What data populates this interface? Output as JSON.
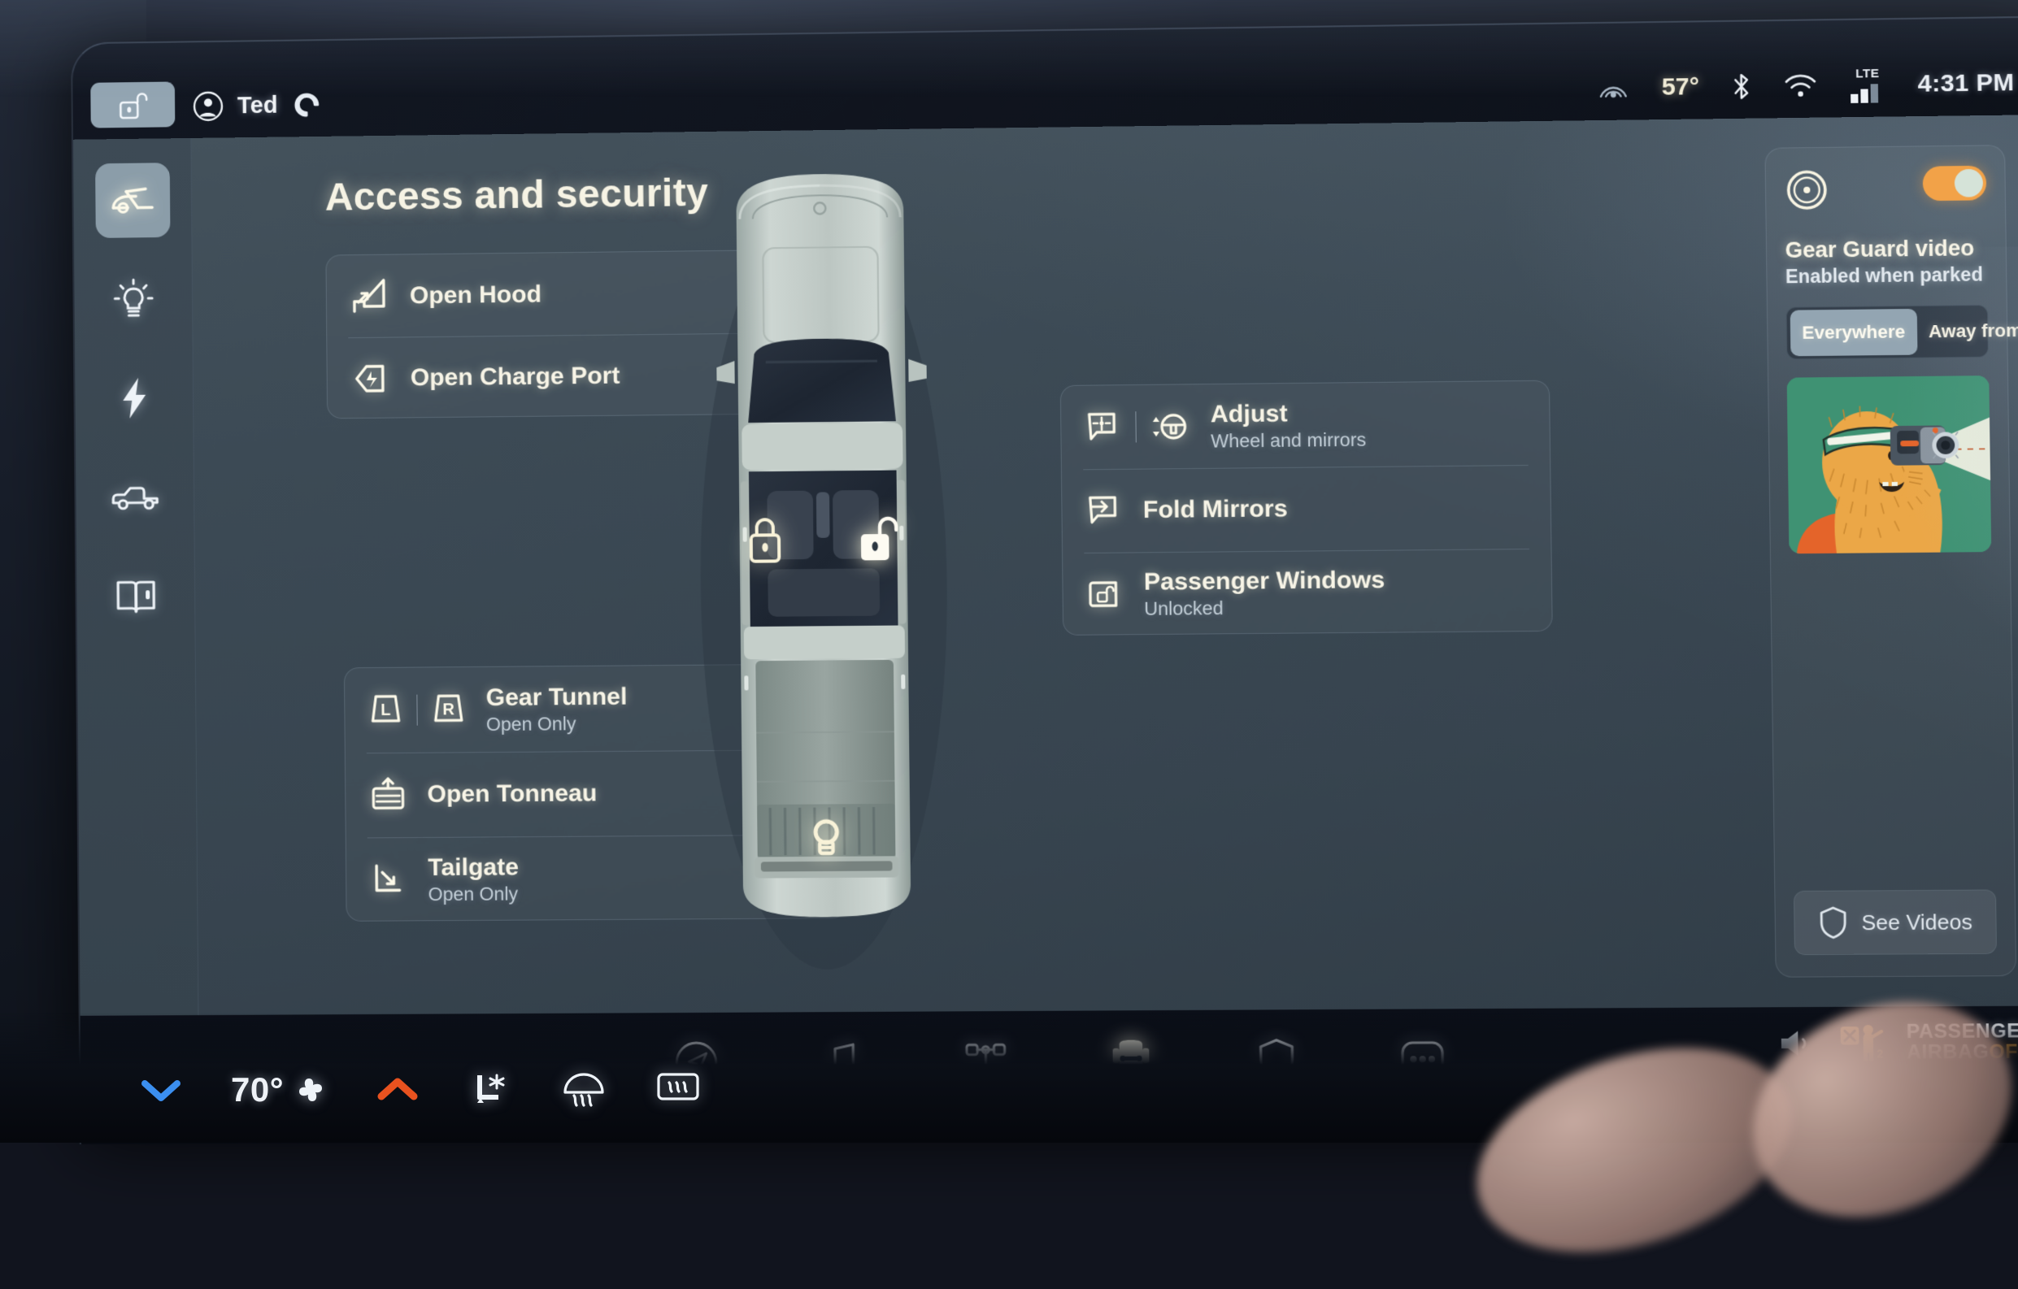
{
  "statusbar": {
    "unlock_icon": "unlock-icon",
    "driver_name": "Ted",
    "assistant_icon": "alexa-icon",
    "radar_icon": "radar-icon",
    "temperature": "57°",
    "bluetooth_icon": "bluetooth-icon",
    "wifi_icon": "wifi-icon",
    "network_label": "LTE",
    "signal_icon": "signal-bars-icon",
    "time": "4:31 PM"
  },
  "sidebar": {
    "items": [
      {
        "name": "access-and-security",
        "icon": "hood-open-icon",
        "active": true
      },
      {
        "name": "lights",
        "icon": "lightbulb-icon",
        "active": false
      },
      {
        "name": "charging",
        "icon": "bolt-icon",
        "active": false
      },
      {
        "name": "vehicle",
        "icon": "truck-icon",
        "active": false
      },
      {
        "name": "manual",
        "icon": "book-icon",
        "active": false
      }
    ]
  },
  "main": {
    "title": "Access and security",
    "front_actions": [
      {
        "title": "Open Hood",
        "subtitle": "",
        "icon": "hood-icon"
      },
      {
        "title": "Open Charge Port",
        "subtitle": "",
        "icon": "charge-port-icon"
      }
    ],
    "rear_actions": [
      {
        "title": "Gear Tunnel",
        "subtitle": "Open Only",
        "icon": "gear-tunnel-icon",
        "left_label": "L",
        "right_label": "R"
      },
      {
        "title": "Open Tonneau",
        "subtitle": "",
        "icon": "tonneau-icon"
      },
      {
        "title": "Tailgate",
        "subtitle": "Open Only",
        "icon": "tailgate-icon"
      }
    ],
    "right_actions": [
      {
        "title": "Adjust",
        "subtitle": "Wheel and mirrors",
        "icon": "mirror-adjust-icon",
        "icon2": "steering-wheel-icon"
      },
      {
        "title": "Fold Mirrors",
        "subtitle": "",
        "icon": "fold-mirror-icon"
      },
      {
        "title": "Passenger Windows",
        "subtitle": "Unlocked",
        "icon": "window-lock-icon"
      }
    ]
  },
  "vehicle": {
    "lock_icon": "lock-closed-icon",
    "unlock_icon": "lock-open-icon",
    "bed_light_icon": "lightbulb-icon",
    "lock_state": "unlocked"
  },
  "gear_guard": {
    "camera_icon": "camera-lens-icon",
    "toggle_on": true,
    "toggle_color": "#f2a248",
    "title": "Gear Guard video",
    "subtitle": "Enabled when parked",
    "segments": [
      {
        "label": "Everywhere",
        "active": true
      },
      {
        "label": "Away from Home",
        "active": false
      }
    ],
    "thumbnail": {
      "alt": "gear-guard-mascot",
      "background_color": "#3f9273",
      "fur_color": "#eba747",
      "jacket_color": "#e4642a"
    },
    "see_videos_label": "See Videos",
    "see_videos_icon": "shield-icon"
  },
  "taskbar": {
    "items": [
      {
        "name": "navigation",
        "icon": "navigation-icon",
        "active": false
      },
      {
        "name": "media",
        "icon": "music-note-icon",
        "active": false
      },
      {
        "name": "drive-modes",
        "icon": "drivetrain-icon",
        "active": false
      },
      {
        "name": "vehicle",
        "icon": "truck-front-icon",
        "active": true
      },
      {
        "name": "gear-guard",
        "icon": "shield-icon",
        "active": false
      },
      {
        "name": "more",
        "icon": "ellipsis-icon",
        "active": false
      }
    ],
    "volume_icon": "speaker-icon",
    "airbag": {
      "icon": "passenger-airbag-off-icon",
      "line1": "PASSENGER",
      "line2": "AIRBAG",
      "status": "OFF",
      "status_color": "#f0a23c"
    }
  },
  "climate": {
    "down_icon": "chevron-down-icon",
    "down_color": "#3b8ff0",
    "temperature": "70°",
    "fan_icon": "fan-icon",
    "up_icon": "chevron-up-icon",
    "up_color": "#e8521f",
    "seat_icon": "seat-cool-icon",
    "front_defrost_icon": "front-defrost-icon",
    "rear_defrost_icon": "rear-defrost-icon"
  }
}
